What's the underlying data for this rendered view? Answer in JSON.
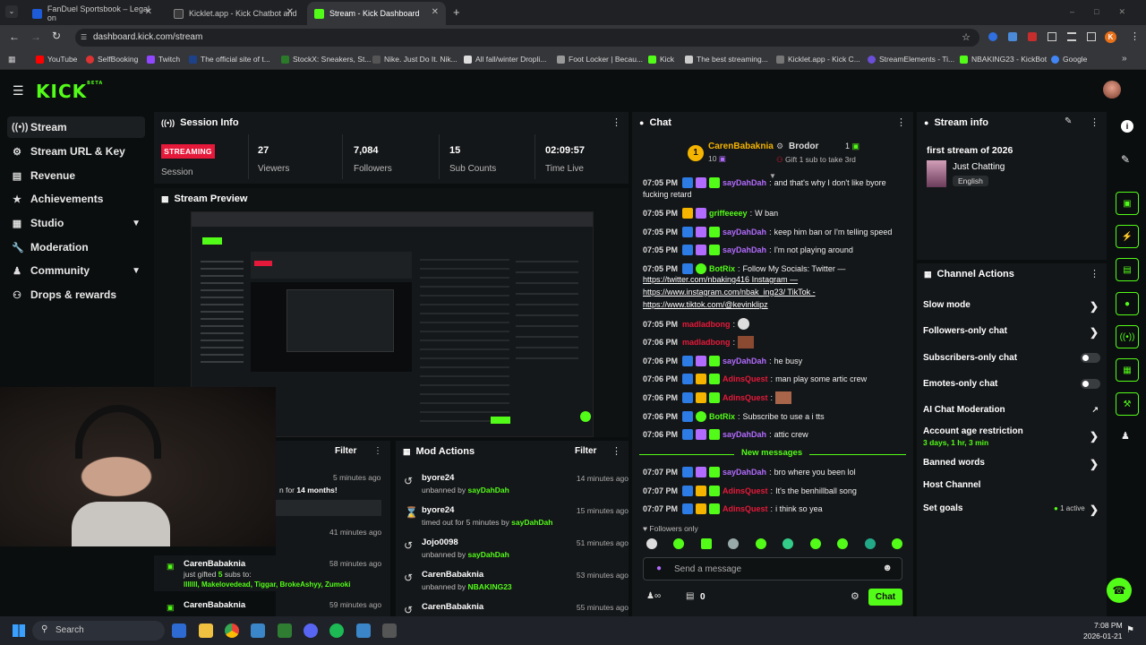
{
  "browser": {
    "tabs": [
      {
        "label": "FanDuel Sportsbook – Legal on",
        "active": false
      },
      {
        "label": "Kicklet.app - Kick Chatbot and",
        "active": false
      },
      {
        "label": "Stream - Kick Dashboard",
        "active": true
      }
    ],
    "url": "dashboard.kick.com/stream",
    "bookmarks": [
      "YouTube",
      "SelfBooking",
      "Twitch",
      "The official site of t...",
      "StockX: Sneakers, St...",
      "Nike. Just Do It. Nik...",
      "All fall/winter Dropli...",
      "Foot Locker | Becau...",
      "Kick",
      "The best streaming...",
      "Kicklet.app - Kick C...",
      "StreamElements - Ti...",
      "NBAKING23 - KickBot",
      "Google"
    ],
    "profile_initial": "K"
  },
  "app": {
    "logo": "KICK",
    "logo_sup": "BETA",
    "sidebar": [
      {
        "label": "Stream",
        "icon": "broadcast-icon",
        "active": true
      },
      {
        "label": "Stream URL & Key",
        "icon": "gear-icon"
      },
      {
        "label": "Revenue",
        "icon": "bank-icon"
      },
      {
        "label": "Achievements",
        "icon": "trophy-icon"
      },
      {
        "label": "Studio",
        "icon": "layout-icon",
        "expand": true
      },
      {
        "label": "Moderation",
        "icon": "wrench-icon"
      },
      {
        "label": "Community",
        "icon": "users-icon",
        "expand": true
      },
      {
        "label": "Drops & rewards",
        "icon": "gift-icon"
      }
    ],
    "session": {
      "title": "Session Info",
      "status": "STREAMING",
      "status_label": "Session",
      "stats": [
        {
          "value": "27",
          "label": "Viewers"
        },
        {
          "value": "7,084",
          "label": "Followers"
        },
        {
          "value": "15",
          "label": "Sub Counts"
        },
        {
          "value": "02:09:57",
          "label": "Time Live"
        }
      ]
    },
    "preview": {
      "title": "Stream Preview"
    },
    "feed": {
      "filter_label": "Filter",
      "items": [
        {
          "time": "5 minutes ago",
          "text_pre": "n for ",
          "highlight": "14 months!"
        },
        {
          "time": "41 minutes ago"
        },
        {
          "name": "CarenBabaknia",
          "line": "just gifted ",
          "count": "5",
          "line2": " subs to:",
          "recipients": "lllllll, Makelovedead, Tiggar, BrokeAshyy, Zumoki",
          "time": "58 minutes ago"
        },
        {
          "name": "CarenBabaknia",
          "time": "59 minutes ago"
        }
      ]
    },
    "mod_actions": {
      "title": "Mod Actions",
      "filter_label": "Filter",
      "items": [
        {
          "user": "byore24",
          "action": "unbanned by ",
          "by": "sayDahDah",
          "time": "14 minutes ago",
          "icon": "undo-icon"
        },
        {
          "user": "byore24",
          "action": "timed out for 5 minutes by ",
          "by": "sayDahDah",
          "time": "15 minutes ago",
          "icon": "hourglass-icon"
        },
        {
          "user": "Jojo0098",
          "action": "unbanned by ",
          "by": "sayDahDah",
          "time": "51 minutes ago",
          "icon": "undo-icon"
        },
        {
          "user": "CarenBabaknia",
          "action": "unbanned by ",
          "by": "NBAKING23",
          "time": "53 minutes ago",
          "icon": "undo-icon"
        },
        {
          "user": "CarenBabaknia",
          "action": "",
          "by": "",
          "time": "55 minutes ago",
          "icon": "undo-icon"
        }
      ]
    },
    "chat": {
      "title": "Chat",
      "leader_rank": "1",
      "leader_name": "CarenBabaknia",
      "leader_count": "10",
      "second_name": "Brodor",
      "second_rank": "1",
      "second_sub": "Gift 1 sub to take 3rd",
      "messages": [
        {
          "time": "",
          "user": "sayDahDah",
          "color": "#b26bff",
          "text": "and that's why I don't like byore",
          "cont": "fucking retard"
        },
        {
          "time": "07:05 PM",
          "user": "griffeeeey",
          "color": "#53fc18",
          "text": "W ban"
        },
        {
          "time": "07:05 PM",
          "user": "sayDahDah",
          "color": "#b26bff",
          "text": "keep him ban or I'm telling speed"
        },
        {
          "time": "07:05 PM",
          "user": "sayDahDah",
          "color": "#b26bff",
          "text": "I'm not playing around"
        },
        {
          "time": "07:05 PM",
          "user": "BotRix",
          "color": "#53fc18",
          "text": "Follow My Socials: Twitter —",
          "links": [
            "https://twitter.com/nbaking416 Instagram —",
            "https://www.instagram.com/nbak_ing23/ TikTok -",
            "https://www.tiktok.com/@kevinklipz"
          ]
        },
        {
          "time": "07:05 PM",
          "user": "madladbong",
          "color": "#e5193a",
          "text": ""
        },
        {
          "time": "07:06 PM",
          "user": "madladbong",
          "color": "#e5193a",
          "text": ""
        },
        {
          "time": "07:06 PM",
          "user": "sayDahDah",
          "color": "#b26bff",
          "text": "he busy"
        },
        {
          "time": "07:06 PM",
          "user": "AdinsQuest",
          "color": "#e5193a",
          "text": "man play some artic crew"
        },
        {
          "time": "07:06 PM",
          "user": "AdinsQuest",
          "color": "#e5193a",
          "text": ""
        },
        {
          "time": "07:06 PM",
          "user": "BotRix",
          "color": "#53fc18",
          "text": "Subscribe to use a i tts"
        },
        {
          "time": "07:06 PM",
          "user": "sayDahDah",
          "color": "#b26bff",
          "text": "attic crew"
        },
        {
          "time": "07:07 PM",
          "user": "sayDahDah",
          "color": "#b26bff",
          "text": "bro where you been lol"
        },
        {
          "time": "07:07 PM",
          "user": "AdinsQuest",
          "color": "#e5193a",
          "text": "It's the benhillball song"
        },
        {
          "time": "07:07 PM",
          "user": "AdinsQuest",
          "color": "#e5193a",
          "text": "i think so yea"
        }
      ],
      "new_messages": "New messages",
      "followers_only": "Followers only",
      "input_placeholder": "Send a message",
      "points": "0",
      "send_label": "Chat"
    },
    "stream_info": {
      "title": "Stream info",
      "stream_title": "first stream of 2026",
      "category": "Just Chatting",
      "language": "English"
    },
    "channel_actions": {
      "title": "Channel Actions",
      "items": [
        {
          "label": "Slow mode",
          "control": "chevron"
        },
        {
          "label": "Followers-only chat",
          "control": "chevron"
        },
        {
          "label": "Subscribers-only chat",
          "control": "toggle"
        },
        {
          "label": "Emotes-only chat",
          "control": "toggle"
        },
        {
          "label": "AI Chat Moderation",
          "control": "external"
        },
        {
          "label": "Account age restriction",
          "sub": "3 days, 1 hr, 3 min",
          "control": "chevron"
        },
        {
          "label": "Banned words",
          "control": "chevron"
        },
        {
          "label": "Host Channel",
          "control": "none"
        },
        {
          "label": "Set goals",
          "status": "1 active",
          "control": "chevron"
        }
      ]
    }
  },
  "taskbar": {
    "search": "Search",
    "time": "7:08 PM",
    "date": "2026-01-21"
  },
  "colors": {
    "kick_green": "#53fc18",
    "live_red": "#e5193a",
    "panel": "#141719",
    "bg": "#0b0e0f"
  }
}
